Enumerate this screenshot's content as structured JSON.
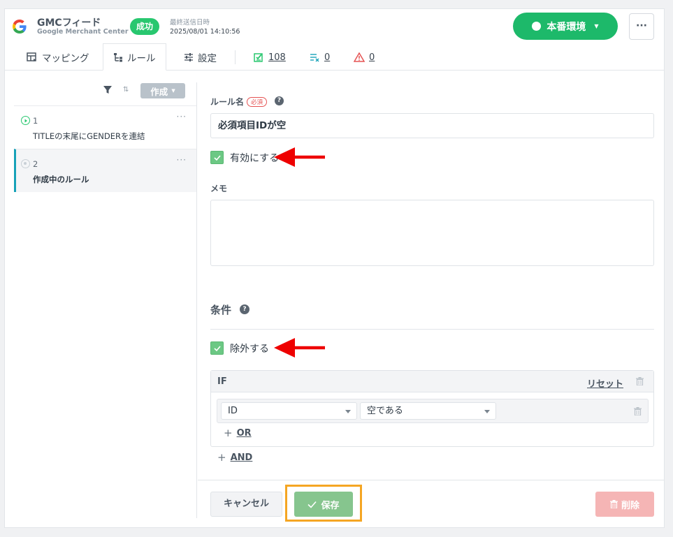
{
  "colors": {
    "accent": "#1db96a",
    "success": "#28c76f",
    "danger": "#e55353",
    "highlight": "#f5a623",
    "selected_border": "#17a2b8"
  },
  "header": {
    "app_title": "GMCフィード",
    "app_subtitle": "Google Merchant Center",
    "status_badge": "成功",
    "last_sent_label": "最終送信日時",
    "last_sent_value": "2025/08/01 14:10:56",
    "env_button_label": "本番環境",
    "more_label": "···"
  },
  "tabs": {
    "mapping": "マッピング",
    "rules": "ルール",
    "settings": "設定",
    "valid_count": "108",
    "excluded_count": "0",
    "warning_count": "0"
  },
  "left_panel": {
    "create_label": "作成",
    "rules": [
      {
        "num": "1",
        "name": "TITLEの末尾にGENDERを連結",
        "state": "active"
      },
      {
        "num": "2",
        "name": "作成中のルール",
        "state": "draft"
      }
    ],
    "item_menu": "···"
  },
  "form": {
    "rule_name_label": "ルール名",
    "required_badge": "必須",
    "rule_name_value": "必須項目IDが空",
    "enable_label": "有効にする",
    "enable_checked": true,
    "memo_label": "メモ",
    "memo_value": "",
    "conditions_title": "条件",
    "exclude_label": "除外する",
    "exclude_checked": true,
    "if_label": "IF",
    "reset_label": "リセット",
    "condition_field": "ID",
    "condition_operator": "空である",
    "or_label": "OR",
    "and_label": "AND"
  },
  "footer": {
    "cancel_label": "キャンセル",
    "save_label": "保存",
    "delete_label": "削除"
  }
}
